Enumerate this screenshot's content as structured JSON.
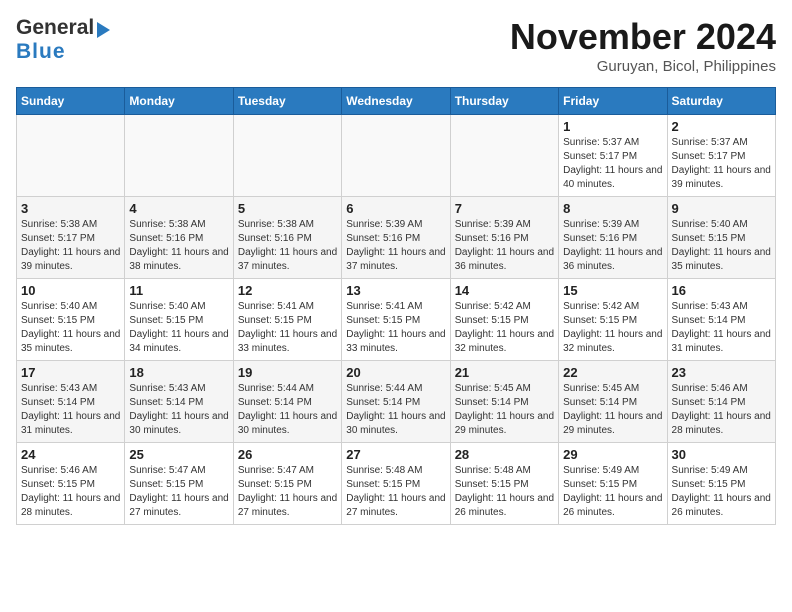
{
  "logo": {
    "line1": "General",
    "line2": "Blue"
  },
  "header": {
    "title": "November 2024",
    "subtitle": "Guruyan, Bicol, Philippines"
  },
  "weekdays": [
    "Sunday",
    "Monday",
    "Tuesday",
    "Wednesday",
    "Thursday",
    "Friday",
    "Saturday"
  ],
  "weeks": [
    [
      {
        "day": "",
        "sunrise": "",
        "sunset": "",
        "daylight": ""
      },
      {
        "day": "",
        "sunrise": "",
        "sunset": "",
        "daylight": ""
      },
      {
        "day": "",
        "sunrise": "",
        "sunset": "",
        "daylight": ""
      },
      {
        "day": "",
        "sunrise": "",
        "sunset": "",
        "daylight": ""
      },
      {
        "day": "",
        "sunrise": "",
        "sunset": "",
        "daylight": ""
      },
      {
        "day": "1",
        "sunrise": "Sunrise: 5:37 AM",
        "sunset": "Sunset: 5:17 PM",
        "daylight": "Daylight: 11 hours and 40 minutes."
      },
      {
        "day": "2",
        "sunrise": "Sunrise: 5:37 AM",
        "sunset": "Sunset: 5:17 PM",
        "daylight": "Daylight: 11 hours and 39 minutes."
      }
    ],
    [
      {
        "day": "3",
        "sunrise": "Sunrise: 5:38 AM",
        "sunset": "Sunset: 5:17 PM",
        "daylight": "Daylight: 11 hours and 39 minutes."
      },
      {
        "day": "4",
        "sunrise": "Sunrise: 5:38 AM",
        "sunset": "Sunset: 5:16 PM",
        "daylight": "Daylight: 11 hours and 38 minutes."
      },
      {
        "day": "5",
        "sunrise": "Sunrise: 5:38 AM",
        "sunset": "Sunset: 5:16 PM",
        "daylight": "Daylight: 11 hours and 37 minutes."
      },
      {
        "day": "6",
        "sunrise": "Sunrise: 5:39 AM",
        "sunset": "Sunset: 5:16 PM",
        "daylight": "Daylight: 11 hours and 37 minutes."
      },
      {
        "day": "7",
        "sunrise": "Sunrise: 5:39 AM",
        "sunset": "Sunset: 5:16 PM",
        "daylight": "Daylight: 11 hours and 36 minutes."
      },
      {
        "day": "8",
        "sunrise": "Sunrise: 5:39 AM",
        "sunset": "Sunset: 5:16 PM",
        "daylight": "Daylight: 11 hours and 36 minutes."
      },
      {
        "day": "9",
        "sunrise": "Sunrise: 5:40 AM",
        "sunset": "Sunset: 5:15 PM",
        "daylight": "Daylight: 11 hours and 35 minutes."
      }
    ],
    [
      {
        "day": "10",
        "sunrise": "Sunrise: 5:40 AM",
        "sunset": "Sunset: 5:15 PM",
        "daylight": "Daylight: 11 hours and 35 minutes."
      },
      {
        "day": "11",
        "sunrise": "Sunrise: 5:40 AM",
        "sunset": "Sunset: 5:15 PM",
        "daylight": "Daylight: 11 hours and 34 minutes."
      },
      {
        "day": "12",
        "sunrise": "Sunrise: 5:41 AM",
        "sunset": "Sunset: 5:15 PM",
        "daylight": "Daylight: 11 hours and 33 minutes."
      },
      {
        "day": "13",
        "sunrise": "Sunrise: 5:41 AM",
        "sunset": "Sunset: 5:15 PM",
        "daylight": "Daylight: 11 hours and 33 minutes."
      },
      {
        "day": "14",
        "sunrise": "Sunrise: 5:42 AM",
        "sunset": "Sunset: 5:15 PM",
        "daylight": "Daylight: 11 hours and 32 minutes."
      },
      {
        "day": "15",
        "sunrise": "Sunrise: 5:42 AM",
        "sunset": "Sunset: 5:15 PM",
        "daylight": "Daylight: 11 hours and 32 minutes."
      },
      {
        "day": "16",
        "sunrise": "Sunrise: 5:43 AM",
        "sunset": "Sunset: 5:14 PM",
        "daylight": "Daylight: 11 hours and 31 minutes."
      }
    ],
    [
      {
        "day": "17",
        "sunrise": "Sunrise: 5:43 AM",
        "sunset": "Sunset: 5:14 PM",
        "daylight": "Daylight: 11 hours and 31 minutes."
      },
      {
        "day": "18",
        "sunrise": "Sunrise: 5:43 AM",
        "sunset": "Sunset: 5:14 PM",
        "daylight": "Daylight: 11 hours and 30 minutes."
      },
      {
        "day": "19",
        "sunrise": "Sunrise: 5:44 AM",
        "sunset": "Sunset: 5:14 PM",
        "daylight": "Daylight: 11 hours and 30 minutes."
      },
      {
        "day": "20",
        "sunrise": "Sunrise: 5:44 AM",
        "sunset": "Sunset: 5:14 PM",
        "daylight": "Daylight: 11 hours and 30 minutes."
      },
      {
        "day": "21",
        "sunrise": "Sunrise: 5:45 AM",
        "sunset": "Sunset: 5:14 PM",
        "daylight": "Daylight: 11 hours and 29 minutes."
      },
      {
        "day": "22",
        "sunrise": "Sunrise: 5:45 AM",
        "sunset": "Sunset: 5:14 PM",
        "daylight": "Daylight: 11 hours and 29 minutes."
      },
      {
        "day": "23",
        "sunrise": "Sunrise: 5:46 AM",
        "sunset": "Sunset: 5:14 PM",
        "daylight": "Daylight: 11 hours and 28 minutes."
      }
    ],
    [
      {
        "day": "24",
        "sunrise": "Sunrise: 5:46 AM",
        "sunset": "Sunset: 5:15 PM",
        "daylight": "Daylight: 11 hours and 28 minutes."
      },
      {
        "day": "25",
        "sunrise": "Sunrise: 5:47 AM",
        "sunset": "Sunset: 5:15 PM",
        "daylight": "Daylight: 11 hours and 27 minutes."
      },
      {
        "day": "26",
        "sunrise": "Sunrise: 5:47 AM",
        "sunset": "Sunset: 5:15 PM",
        "daylight": "Daylight: 11 hours and 27 minutes."
      },
      {
        "day": "27",
        "sunrise": "Sunrise: 5:48 AM",
        "sunset": "Sunset: 5:15 PM",
        "daylight": "Daylight: 11 hours and 27 minutes."
      },
      {
        "day": "28",
        "sunrise": "Sunrise: 5:48 AM",
        "sunset": "Sunset: 5:15 PM",
        "daylight": "Daylight: 11 hours and 26 minutes."
      },
      {
        "day": "29",
        "sunrise": "Sunrise: 5:49 AM",
        "sunset": "Sunset: 5:15 PM",
        "daylight": "Daylight: 11 hours and 26 minutes."
      },
      {
        "day": "30",
        "sunrise": "Sunrise: 5:49 AM",
        "sunset": "Sunset: 5:15 PM",
        "daylight": "Daylight: 11 hours and 26 minutes."
      }
    ]
  ]
}
